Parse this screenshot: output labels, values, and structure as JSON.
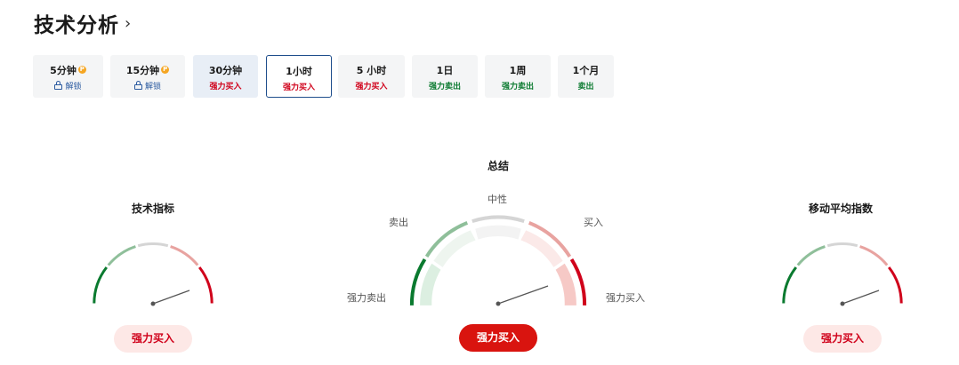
{
  "header": {
    "title": "技术分析",
    "chevron": "›"
  },
  "tabs": [
    {
      "label": "5分钟",
      "pro": "P",
      "signal": "解锁",
      "kind": "lock"
    },
    {
      "label": "15分钟",
      "pro": "P",
      "signal": "解锁",
      "kind": "lock"
    },
    {
      "label": "30分钟",
      "signal": "强力买入",
      "kind": "buy"
    },
    {
      "label": "1小时",
      "signal": "强力买入",
      "kind": "buy"
    },
    {
      "label": "5 小时",
      "signal": "强力买入",
      "kind": "buy"
    },
    {
      "label": "1日",
      "signal": "强力卖出",
      "kind": "sell"
    },
    {
      "label": "1周",
      "signal": "强力卖出",
      "kind": "sell"
    },
    {
      "label": "1个月",
      "signal": "卖出",
      "kind": "sell"
    }
  ],
  "gauges": {
    "indicators": {
      "title": "技术指标",
      "result": "强力买入"
    },
    "summary": {
      "title": "总结",
      "result": "强力买入",
      "labels": {
        "strong_sell": "强力卖出",
        "sell": "卖出",
        "neutral": "中性",
        "buy": "买入",
        "strong_buy": "强力买入"
      }
    },
    "moving_averages": {
      "title": "移动平均指数",
      "result": "强力买入"
    }
  },
  "colors": {
    "strong_buy": "#d0021b",
    "strong_sell": "#0a7a2f",
    "selected_border": "#1f4e8c"
  }
}
